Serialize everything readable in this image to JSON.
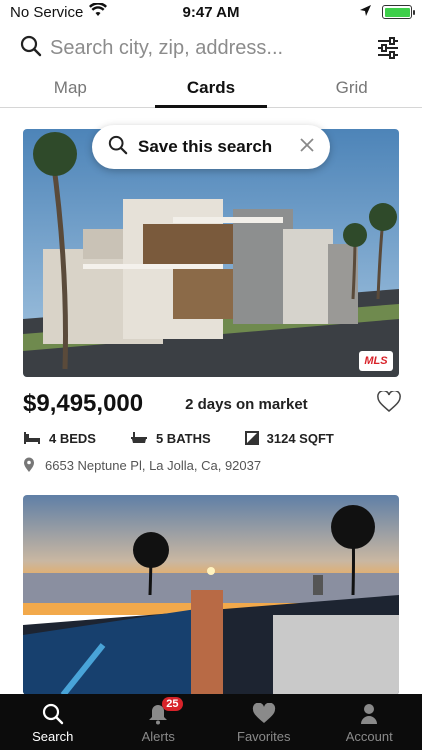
{
  "status_bar": {
    "carrier": "No Service",
    "time": "9:47 AM"
  },
  "search": {
    "placeholder": "Search city, zip, address..."
  },
  "tabs": [
    {
      "label": "Map",
      "active": false
    },
    {
      "label": "Cards",
      "active": true
    },
    {
      "label": "Grid",
      "active": false
    }
  ],
  "save_search": {
    "label": "Save this search"
  },
  "listing": {
    "price": "$9,495,000",
    "days_on_market": "2 days on market",
    "beds": "4 BEDS",
    "baths": "5 BATHS",
    "sqft": "3124 SQFT",
    "address": "6653 Neptune Pl, La Jolla, Ca, 92037",
    "mls_logo": "MLS"
  },
  "bottom_nav": [
    {
      "label": "Search",
      "icon": "search-icon",
      "active": true
    },
    {
      "label": "Alerts",
      "icon": "bell-icon",
      "badge": "25"
    },
    {
      "label": "Favorites",
      "icon": "heart-icon"
    },
    {
      "label": "Account",
      "icon": "person-icon"
    }
  ],
  "colors": {
    "accent_red": "#d8232a",
    "battery_green": "#3ecf4a",
    "nav_background": "#0c0c0c"
  }
}
